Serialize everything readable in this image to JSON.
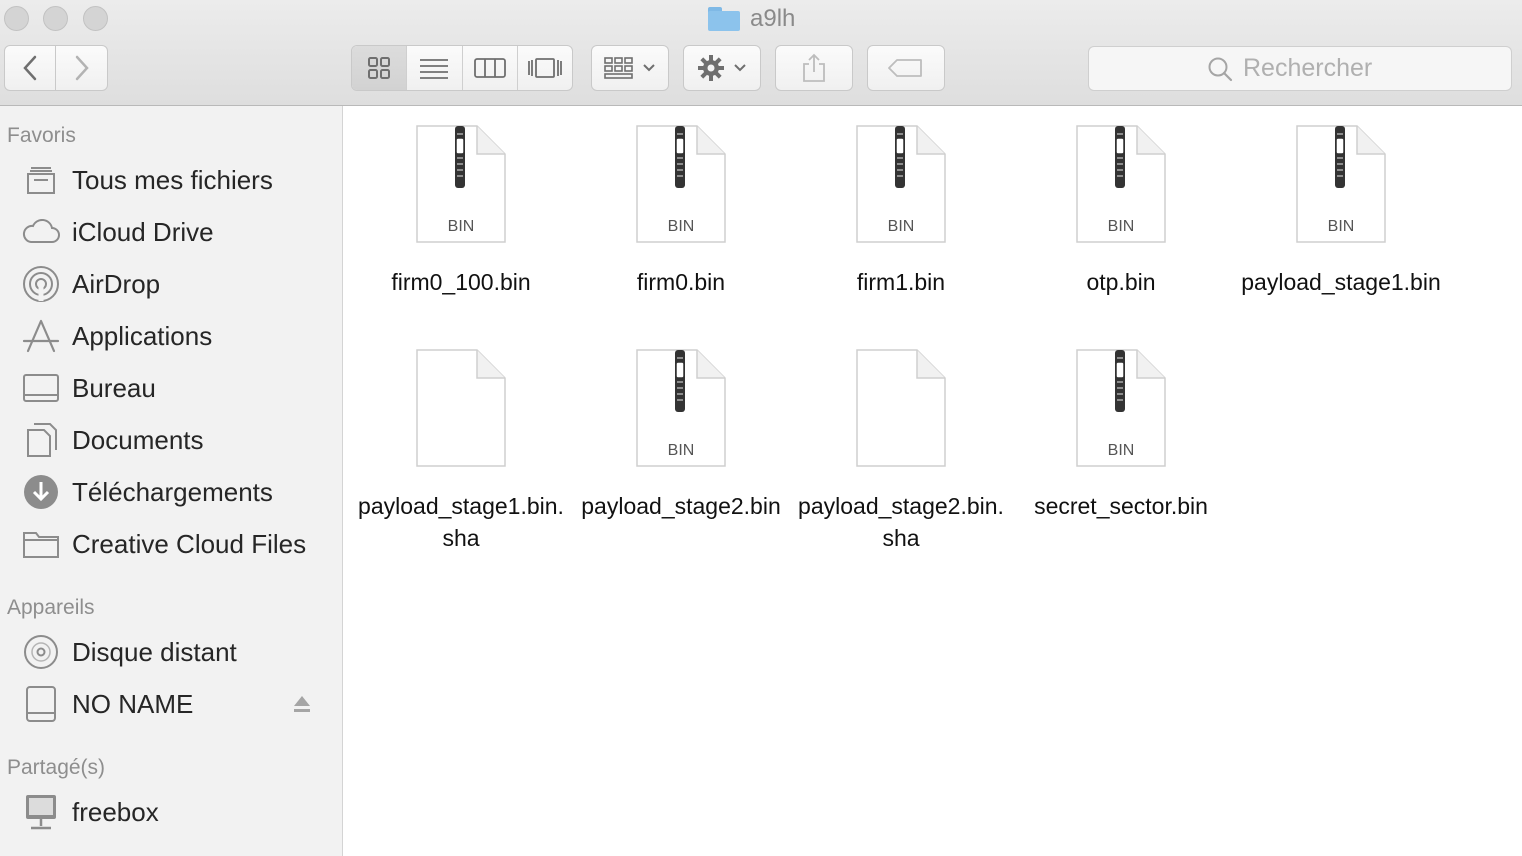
{
  "window": {
    "title": "a9lh",
    "folder_icon": "folder-icon"
  },
  "toolbar": {
    "back_icon": "chevron-left-icon",
    "forward_icon": "chevron-right-icon",
    "views": [
      "icon-view-icon",
      "list-view-icon",
      "column-view-icon",
      "cover-flow-icon"
    ],
    "active_view": 0,
    "arrange_icon": "arrange-grid-icon",
    "action_icon": "gear-icon",
    "share_icon": "share-icon",
    "tag_icon": "tag-icon"
  },
  "search": {
    "placeholder": "Rechercher",
    "value": ""
  },
  "sidebar": {
    "favorites_title": "Favoris",
    "favorites": [
      {
        "label": "Tous mes fichiers",
        "icon": "all-files-icon"
      },
      {
        "label": "iCloud Drive",
        "icon": "cloud-icon"
      },
      {
        "label": "AirDrop",
        "icon": "airdrop-icon"
      },
      {
        "label": "Applications",
        "icon": "applications-icon"
      },
      {
        "label": "Bureau",
        "icon": "desktop-icon"
      },
      {
        "label": "Documents",
        "icon": "documents-icon"
      },
      {
        "label": "Téléchargements",
        "icon": "downloads-icon"
      },
      {
        "label": "Creative Cloud Files",
        "icon": "folder-icon"
      }
    ],
    "devices_title": "Appareils",
    "devices": [
      {
        "label": "Disque distant",
        "icon": "disc-icon"
      },
      {
        "label": "NO NAME",
        "icon": "drive-icon",
        "ejectable": true
      }
    ],
    "shared_title": "Partagé(s)",
    "shared": [
      {
        "label": "freebox",
        "icon": "network-computer-icon"
      }
    ]
  },
  "files": [
    {
      "name": "firm0_100.bin",
      "kind": "zip",
      "badge": "BIN"
    },
    {
      "name": "firm0.bin",
      "kind": "zip",
      "badge": "BIN"
    },
    {
      "name": "firm1.bin",
      "kind": "zip",
      "badge": "BIN"
    },
    {
      "name": "otp.bin",
      "kind": "zip",
      "badge": "BIN"
    },
    {
      "name": "payload_stage1.bin",
      "kind": "zip",
      "badge": "BIN"
    },
    {
      "name": "payload_stage1.bin.sha",
      "kind": "blank",
      "badge": ""
    },
    {
      "name": "payload_stage2.bin",
      "kind": "zip",
      "badge": "BIN"
    },
    {
      "name": "payload_stage2.bin.sha",
      "kind": "blank",
      "badge": ""
    },
    {
      "name": "secret_sector.bin",
      "kind": "zip",
      "badge": "BIN"
    }
  ]
}
